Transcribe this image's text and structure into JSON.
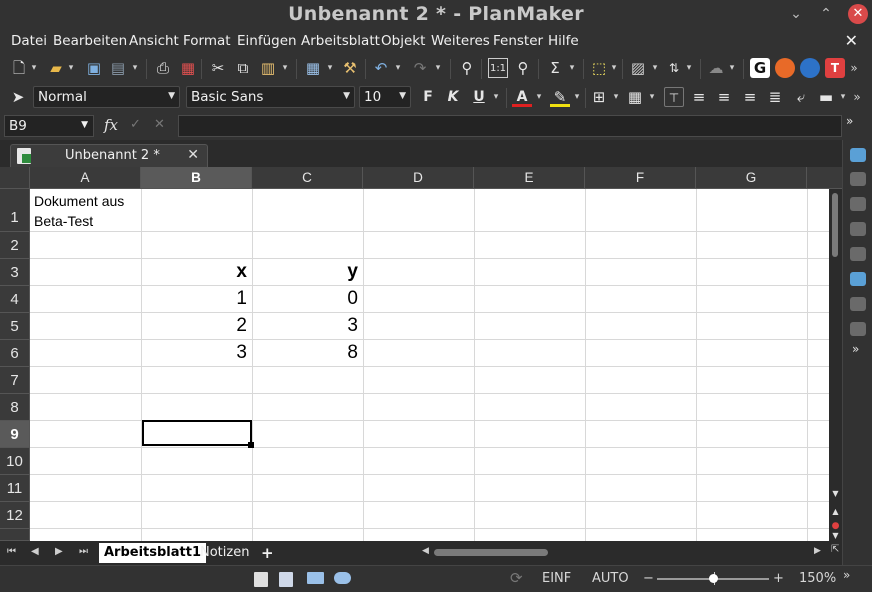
{
  "window": {
    "title": "Unbenannt 2 * - PlanMaker",
    "minimize": "⌄",
    "maximize": "⌃",
    "close": "✕"
  },
  "menu": {
    "items": [
      "Datei",
      "Bearbeiten",
      "Ansicht",
      "Format",
      "Einfügen",
      "Arbeitsblatt",
      "Objekt",
      "Weiteres",
      "Fenster",
      "Hilfe"
    ],
    "close": "✕"
  },
  "format_bar": {
    "style": "Normal",
    "font": "Basic Sans",
    "size": "10",
    "bold": "F",
    "italic": "K",
    "underline": "U",
    "font_color_letter": "A",
    "font_color": "#e02020",
    "highlight_color": "#f0e010"
  },
  "formula_bar": {
    "cell_ref": "B9",
    "fx": "fx",
    "confirm": "✓",
    "cancel": "✕",
    "formula": ""
  },
  "document_tab": {
    "label": "Unbenannt 2 *",
    "close": "✕"
  },
  "grid": {
    "columns": [
      "A",
      "B",
      "C",
      "D",
      "E",
      "F",
      "G"
    ],
    "selected_column": "B",
    "rows": [
      "1",
      "2",
      "3",
      "4",
      "5",
      "6",
      "7",
      "8",
      "9",
      "10",
      "11",
      "12"
    ],
    "selected_row": "9",
    "cells": {
      "A1": "Dokument aus\nBeta-Test",
      "B3": "x",
      "C3": "y",
      "B4": "1",
      "C4": "0",
      "B5": "2",
      "C5": "3",
      "B6": "3",
      "C6": "8"
    }
  },
  "sheet_tabs": {
    "tabs": [
      "Arbeitsblatt1",
      "Notizen"
    ],
    "active": "Arbeitsblatt1",
    "add": "+"
  },
  "status": {
    "mode": "EINF",
    "calc": "AUTO",
    "zoom": "150%",
    "zoom_fraction": 0.5,
    "zoom_minus": "−",
    "zoom_plus": "+"
  },
  "icons": {
    "toolbar1": [
      "new-document-icon",
      "open-folder-icon",
      "save-icon",
      "save-all-icon",
      "print-icon",
      "pdf-export-icon",
      "cut-icon",
      "copy-icon",
      "paste-icon",
      "table-format-icon",
      "format-painter-icon",
      "undo-icon",
      "redo-icon",
      "search-icon",
      "goto-cell-icon",
      "zoom-icon",
      "sum-icon",
      "insert-object-icon",
      "chart-icon",
      "sort-icon",
      "cloud-icon",
      "grammar-icon",
      "firefox-icon",
      "thunderbird-icon",
      "textmaker-icon"
    ],
    "sidepanel": [
      "comment-icon",
      "comment-previous-icon",
      "comment-next-icon",
      "comment-edit-icon",
      "comment-delete-icon",
      "comment-show-icon",
      "comment-reply-icon",
      "comment-resolve-icon"
    ]
  }
}
